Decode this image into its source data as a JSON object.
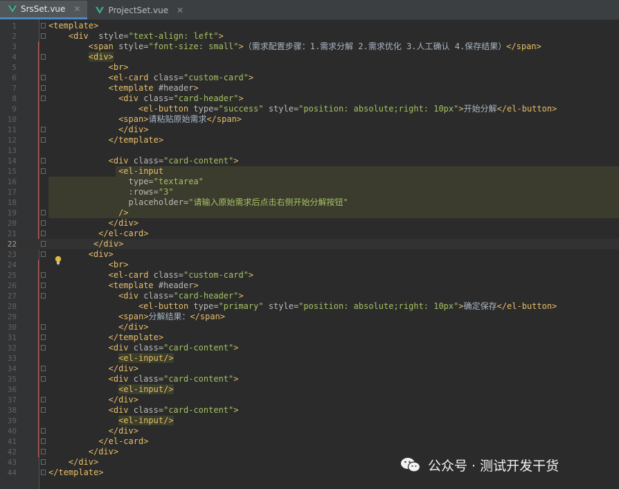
{
  "tabs": [
    {
      "label": "SrsSet.vue",
      "active": true
    },
    {
      "label": "ProjectSet.vue",
      "active": false
    }
  ],
  "current_line": 22,
  "lines": [
    {
      "n": 1,
      "indent": 0,
      "tokens": [
        [
          "tag",
          "<template>"
        ]
      ]
    },
    {
      "n": 2,
      "indent": 4,
      "tokens": [
        [
          "tag",
          "<div"
        ],
        [
          "attr",
          "  style="
        ],
        [
          "val",
          "\"text-align: left\""
        ],
        [
          "tag",
          ">"
        ]
      ]
    },
    {
      "n": 3,
      "indent": 8,
      "tokens": [
        [
          "tag",
          "<span"
        ],
        [
          "attr",
          " style="
        ],
        [
          "val",
          "\"font-size: small\""
        ],
        [
          "tag",
          ">"
        ],
        [
          "txt",
          "（需求配置步骤：1.需求分解 2.需求优化 3.人工确认 4.保存结果）"
        ],
        [
          "tag",
          "</span>"
        ]
      ]
    },
    {
      "n": 4,
      "indent": 8,
      "tokens": [
        [
          "tagbg",
          "<div>"
        ]
      ]
    },
    {
      "n": 5,
      "indent": 12,
      "tokens": [
        [
          "tag",
          "<br>"
        ]
      ]
    },
    {
      "n": 6,
      "indent": 12,
      "tokens": [
        [
          "tag",
          "<el-card"
        ],
        [
          "attr",
          " class="
        ],
        [
          "val",
          "\"custom-card\""
        ],
        [
          "tag",
          ">"
        ]
      ]
    },
    {
      "n": 7,
      "indent": 12,
      "tokens": [
        [
          "tag",
          "<template"
        ],
        [
          "attr",
          " #header"
        ],
        [
          "tag",
          ">"
        ]
      ]
    },
    {
      "n": 8,
      "indent": 14,
      "tokens": [
        [
          "tag",
          "<div"
        ],
        [
          "attr",
          " class="
        ],
        [
          "val",
          "\"card-header\""
        ],
        [
          "tag",
          ">"
        ]
      ]
    },
    {
      "n": 9,
      "indent": 18,
      "tokens": [
        [
          "tag",
          "<el-button"
        ],
        [
          "attr",
          " type="
        ],
        [
          "val",
          "\"success\""
        ],
        [
          "attr",
          " style="
        ],
        [
          "val",
          "\"position: absolute;right: 10px\""
        ],
        [
          "tag",
          ">"
        ],
        [
          "txt",
          "开始分解"
        ],
        [
          "tag",
          "</el-button>"
        ]
      ]
    },
    {
      "n": 10,
      "indent": 14,
      "tokens": [
        [
          "tag",
          "<span>"
        ],
        [
          "txt",
          "请粘贴原始需求"
        ],
        [
          "tag",
          "</span>"
        ]
      ]
    },
    {
      "n": 11,
      "indent": 14,
      "tokens": [
        [
          "tag",
          "</div>"
        ]
      ]
    },
    {
      "n": 12,
      "indent": 12,
      "tokens": [
        [
          "tag",
          "</template>"
        ]
      ]
    },
    {
      "n": 13,
      "indent": 0,
      "tokens": []
    },
    {
      "n": 14,
      "indent": 12,
      "tokens": [
        [
          "tag",
          "<div"
        ],
        [
          "attr",
          " class="
        ],
        [
          "val",
          "\"card-content\""
        ],
        [
          "tag",
          ">"
        ]
      ]
    },
    {
      "n": 15,
      "indent": 14,
      "tokens": [
        [
          "tag",
          "<el-input"
        ]
      ]
    },
    {
      "n": 16,
      "indent": 16,
      "tokens": [
        [
          "attr",
          "type="
        ],
        [
          "val",
          "\"textarea\""
        ]
      ]
    },
    {
      "n": 17,
      "indent": 16,
      "tokens": [
        [
          "attr",
          ":rows="
        ],
        [
          "val",
          "\"3\""
        ]
      ]
    },
    {
      "n": 18,
      "indent": 16,
      "tokens": [
        [
          "attr",
          "placeholder="
        ],
        [
          "val",
          "\"请输入原始需求后点击右侧开始分解按钮\""
        ]
      ]
    },
    {
      "n": 19,
      "indent": 14,
      "tokens": [
        [
          "tag",
          "/>"
        ]
      ]
    },
    {
      "n": 20,
      "indent": 12,
      "tokens": [
        [
          "tag",
          "</div>"
        ]
      ]
    },
    {
      "n": 21,
      "indent": 10,
      "tokens": [
        [
          "tag",
          "</el-card>"
        ]
      ]
    },
    {
      "n": 22,
      "indent": 9,
      "tokens": [
        [
          "tag",
          "</div>"
        ]
      ]
    },
    {
      "n": 23,
      "indent": 8,
      "tokens": [
        [
          "tag",
          "<div>"
        ]
      ]
    },
    {
      "n": 24,
      "indent": 12,
      "tokens": [
        [
          "tag",
          "<br>"
        ]
      ]
    },
    {
      "n": 25,
      "indent": 12,
      "tokens": [
        [
          "tag",
          "<el-card"
        ],
        [
          "attr",
          " class="
        ],
        [
          "val",
          "\"custom-card\""
        ],
        [
          "tag",
          ">"
        ]
      ]
    },
    {
      "n": 26,
      "indent": 12,
      "tokens": [
        [
          "tag",
          "<template"
        ],
        [
          "attr",
          " #header"
        ],
        [
          "tag",
          ">"
        ]
      ]
    },
    {
      "n": 27,
      "indent": 14,
      "tokens": [
        [
          "tag",
          "<div"
        ],
        [
          "attr",
          " class="
        ],
        [
          "val",
          "\"card-header\""
        ],
        [
          "tag",
          ">"
        ]
      ]
    },
    {
      "n": 28,
      "indent": 18,
      "tokens": [
        [
          "tag",
          "<el-button"
        ],
        [
          "attr",
          " type="
        ],
        [
          "val",
          "\"primary\""
        ],
        [
          "attr",
          " style="
        ],
        [
          "val",
          "\"position: absolute;right: 10px\""
        ],
        [
          "tag",
          ">"
        ],
        [
          "txt",
          "确定保存"
        ],
        [
          "tag",
          "</el-button>"
        ]
      ]
    },
    {
      "n": 29,
      "indent": 14,
      "tokens": [
        [
          "tag",
          "<span>"
        ],
        [
          "txt",
          "分解结果："
        ],
        [
          "tag",
          "</span>"
        ]
      ]
    },
    {
      "n": 30,
      "indent": 14,
      "tokens": [
        [
          "tag",
          "</div>"
        ]
      ]
    },
    {
      "n": 31,
      "indent": 12,
      "tokens": [
        [
          "tag",
          "</template>"
        ]
      ]
    },
    {
      "n": 32,
      "indent": 12,
      "tokens": [
        [
          "tag",
          "<div"
        ],
        [
          "attr",
          " class="
        ],
        [
          "val",
          "\"card-content\""
        ],
        [
          "tag",
          ">"
        ]
      ]
    },
    {
      "n": 33,
      "indent": 14,
      "tokens": [
        [
          "tagbg",
          "<el-input/>"
        ]
      ]
    },
    {
      "n": 34,
      "indent": 12,
      "tokens": [
        [
          "tag",
          "</div>"
        ]
      ]
    },
    {
      "n": 35,
      "indent": 12,
      "tokens": [
        [
          "tag",
          "<div"
        ],
        [
          "attr",
          " class="
        ],
        [
          "val",
          "\"card-content\""
        ],
        [
          "tag",
          ">"
        ]
      ]
    },
    {
      "n": 36,
      "indent": 14,
      "tokens": [
        [
          "tagbg",
          "<el-input/>"
        ]
      ]
    },
    {
      "n": 37,
      "indent": 12,
      "tokens": [
        [
          "tag",
          "</div>"
        ]
      ]
    },
    {
      "n": 38,
      "indent": 12,
      "tokens": [
        [
          "tag",
          "<div"
        ],
        [
          "attr",
          " class="
        ],
        [
          "val",
          "\"card-content\""
        ],
        [
          "tag",
          ">"
        ]
      ]
    },
    {
      "n": 39,
      "indent": 14,
      "tokens": [
        [
          "tagbg",
          "<el-input/>"
        ]
      ]
    },
    {
      "n": 40,
      "indent": 12,
      "tokens": [
        [
          "tag",
          "</div>"
        ]
      ]
    },
    {
      "n": 41,
      "indent": 10,
      "tokens": [
        [
          "tag",
          "</el-card>"
        ]
      ]
    },
    {
      "n": 42,
      "indent": 8,
      "tokens": [
        [
          "tag",
          "</div>"
        ]
      ]
    },
    {
      "n": 43,
      "indent": 4,
      "tokens": [
        [
          "tag",
          "</div>"
        ]
      ]
    },
    {
      "n": 44,
      "indent": 0,
      "tokens": [
        [
          "tag",
          "</template>"
        ]
      ]
    }
  ],
  "watermark": {
    "text": "公众号 · 测试开发干货",
    "icon": "wechat-icon"
  },
  "colors": {
    "tag": "#e8bf6a",
    "attr": "#bababa",
    "value": "#a5c261",
    "text": "#a9b7c6",
    "background": "#2b2b2b",
    "active_tab_border": "#4a88c7"
  }
}
